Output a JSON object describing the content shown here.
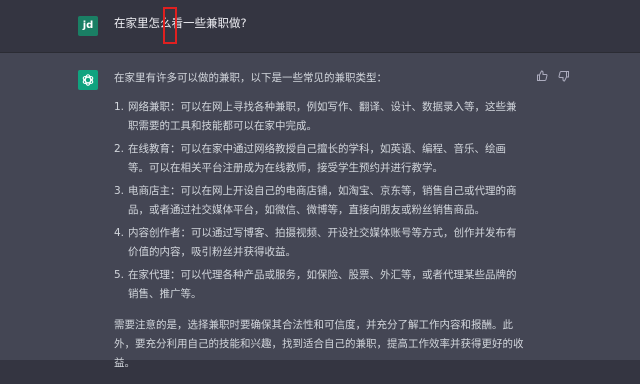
{
  "user": {
    "avatar_text": "jd",
    "question": "在家里怎么看一些兼职做?"
  },
  "assistant": {
    "intro": "在家里有许多可以做的兼职，以下是一些常见的兼职类型：",
    "items": [
      {
        "num": "1.",
        "text": "网络兼职：可以在网上寻找各种兼职，例如写作、翻译、设计、数据录入等，这些兼职需要的工具和技能都可以在家中完成。"
      },
      {
        "num": "2.",
        "text": "在线教育：可以在家中通过网络教授自己擅长的学科，如英语、编程、音乐、绘画等。可以在相关平台注册成为在线教师，接受学生预约并进行教学。"
      },
      {
        "num": "3.",
        "text": "电商店主：可以在网上开设自己的电商店铺，如淘宝、京东等，销售自己或代理的商品，或者通过社交媒体平台，如微信、微博等，直接向朋友或粉丝销售商品。"
      },
      {
        "num": "4.",
        "text": "内容创作者：可以通过写博客、拍摄视频、开设社交媒体账号等方式，创作并发布有价值的内容，吸引粉丝并获得收益。"
      },
      {
        "num": "5.",
        "text": "在家代理：可以代理各种产品或服务，如保险、股票、外汇等，或者代理某些品牌的销售、推广等。"
      }
    ],
    "outro": "需要注意的是，选择兼职时要确保其合法性和可信度，并充分了解工作内容和报酬。此外，要充分利用自己的技能和兴趣，找到适合自己的兼职，提高工作效率并获得更好的收益。"
  },
  "icons": {
    "thumbs_up": "thumbs-up-icon",
    "thumbs_down": "thumbs-down-icon",
    "bot_logo": "openai-logo-icon"
  },
  "colors": {
    "user_bg": "#343541",
    "assistant_bg": "#444654",
    "user_avatar": "#1a7f64",
    "bot_avatar": "#10a37f",
    "highlight": "#e02020"
  }
}
